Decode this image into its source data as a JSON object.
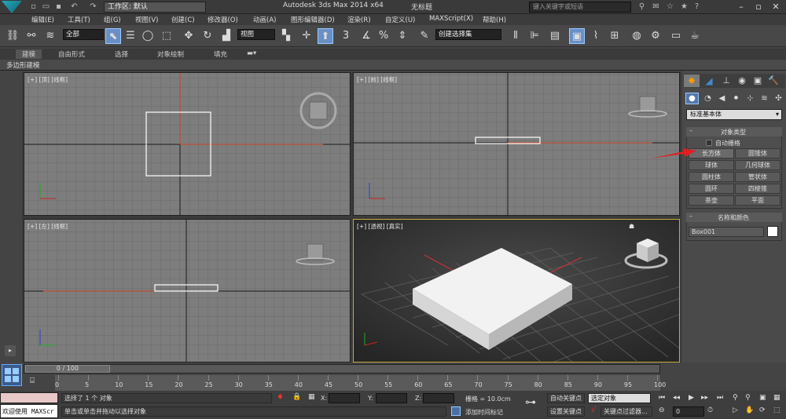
{
  "titlebar": {
    "workspace": "工作区: 默认",
    "app_title": "Autodesk 3ds Max  2014 x64",
    "doc_title": "无标题",
    "search_placeholder": "键入关键字或短语"
  },
  "menus": [
    "编辑(E)",
    "工具(T)",
    "组(G)",
    "视图(V)",
    "创建(C)",
    "修改器(O)",
    "动画(A)",
    "图形编辑器(D)",
    "渲染(R)",
    "自定义(U)",
    "MAXScript(X)",
    "帮助(H)"
  ],
  "toolbar": {
    "selection_filter": "全部",
    "ref_coord": "视图",
    "named_selection": "创建选择集",
    "snap_3": "3",
    "snap_pct": "%"
  },
  "ribbon": {
    "tabs": [
      "建模",
      "自由形式",
      "选择",
      "对象绘制",
      "填充"
    ],
    "sub_label": "多边形建模"
  },
  "viewports": {
    "top": "[+] [顶] [线框]",
    "front": "[+] [前] [线框]",
    "left": "[+] [左] [线框]",
    "perspective": "[+] [透视] [真实]"
  },
  "command_panel": {
    "category": "标准基本体",
    "object_type_title": "对象类型",
    "autogrid": "自动栅格",
    "buttons": [
      "长方体",
      "圆锥体",
      "球体",
      "几何球体",
      "圆柱体",
      "管状体",
      "圆环",
      "四棱锥",
      "茶壶",
      "平面"
    ],
    "name_color_title": "名称和颜色",
    "object_name": "Box001",
    "object_color": "#ffffff"
  },
  "timeline": {
    "frame_display": "0 / 100",
    "ticks": [
      "0",
      "5",
      "10",
      "15",
      "20",
      "25",
      "30",
      "35",
      "40",
      "45",
      "50",
      "55",
      "60",
      "65",
      "70",
      "75",
      "80",
      "85",
      "90",
      "95",
      "100"
    ]
  },
  "status": {
    "maxscript": "欢迎使用 MAXScr",
    "selected": "选择了 1 个 对象",
    "prompt": "单击或单击并拖动以选择对象",
    "x_label": "X:",
    "y_label": "Y:",
    "z_label": "Z:",
    "grid": "栅格 = 10.0cm",
    "add_time_tag": "添加时间标记",
    "auto_key": "自动关键点",
    "set_key": "设置关键点",
    "selected_set": "选定对象",
    "key_filters": "关键点过滤器...",
    "frame": "0"
  }
}
